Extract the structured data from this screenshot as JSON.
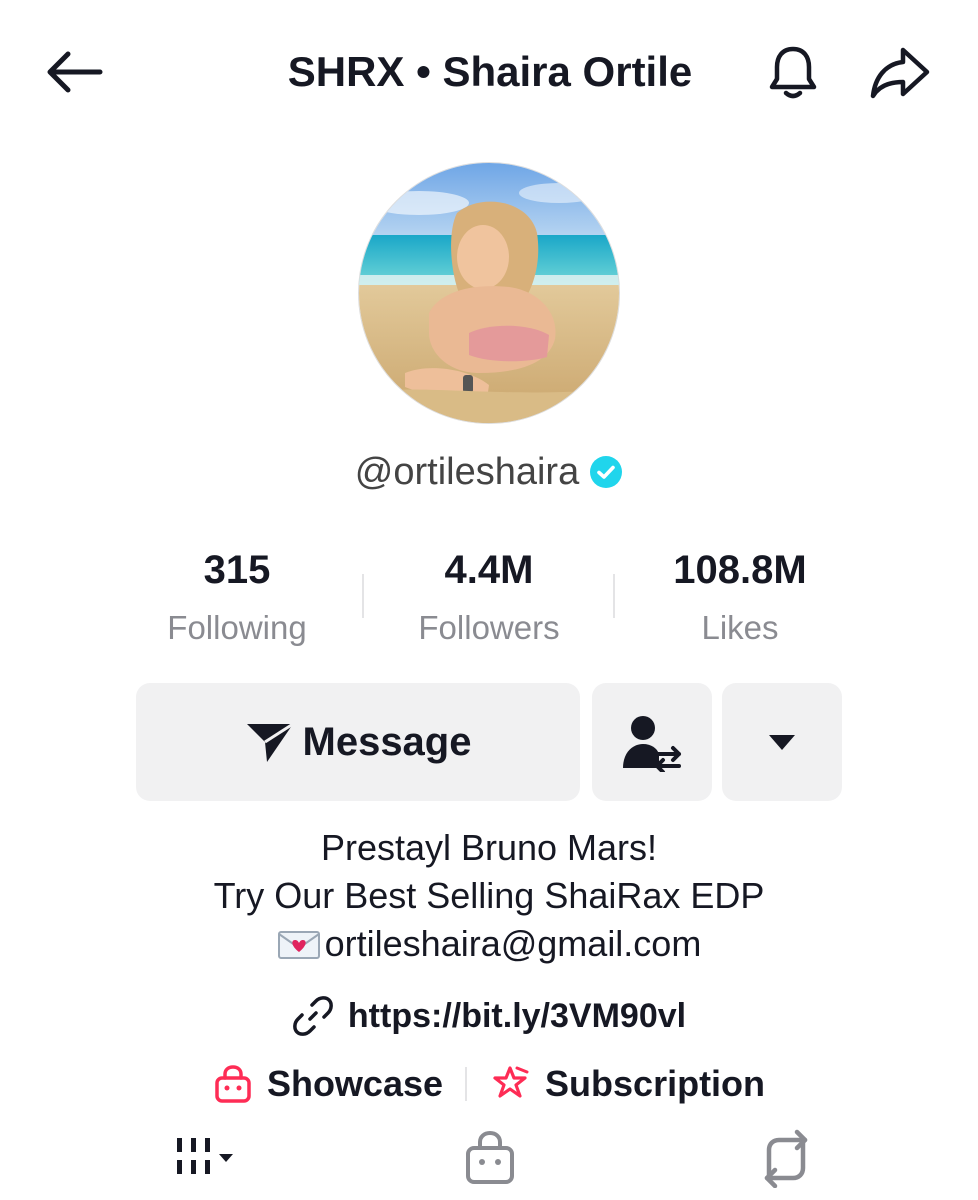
{
  "header": {
    "title": "SHRX • Shaira Ortile",
    "back_icon": "arrow-left-icon",
    "bell_icon": "bell-icon",
    "share_icon": "share-arrow-icon"
  },
  "profile": {
    "avatar_icon": "profile-photo",
    "handle": "@ortileshaira",
    "verified_icon": "verified-badge-icon",
    "verified_color": "#20d5ec"
  },
  "stats": [
    {
      "value": "315",
      "label": "Following"
    },
    {
      "value": "4.4M",
      "label": "Followers"
    },
    {
      "value": "108.8M",
      "label": "Likes"
    }
  ],
  "actions": {
    "message_label": "Message",
    "message_icon": "send-icon",
    "friend_icon": "user-switch-icon",
    "more_icon": "caret-down-icon"
  },
  "bio": {
    "lines": [
      "Prestayl Bruno Mars!",
      "Try Our Best Selling ShaiRax EDP"
    ],
    "email": "ortileshaira@gmail.com",
    "email_icon": "love-letter-icon"
  },
  "link": {
    "url": "https://bit.ly/3VM90vl",
    "icon": "link-icon"
  },
  "chips": [
    {
      "label": "Showcase",
      "icon": "shopping-bag-icon",
      "color": "#fe2c55"
    },
    {
      "label": "Subscription",
      "icon": "star-badge-icon",
      "color": "#fe2c55"
    }
  ],
  "tabs": [
    {
      "icon": "grid-icon"
    },
    {
      "icon": "shop-bag-icon"
    },
    {
      "icon": "repost-icon"
    }
  ]
}
